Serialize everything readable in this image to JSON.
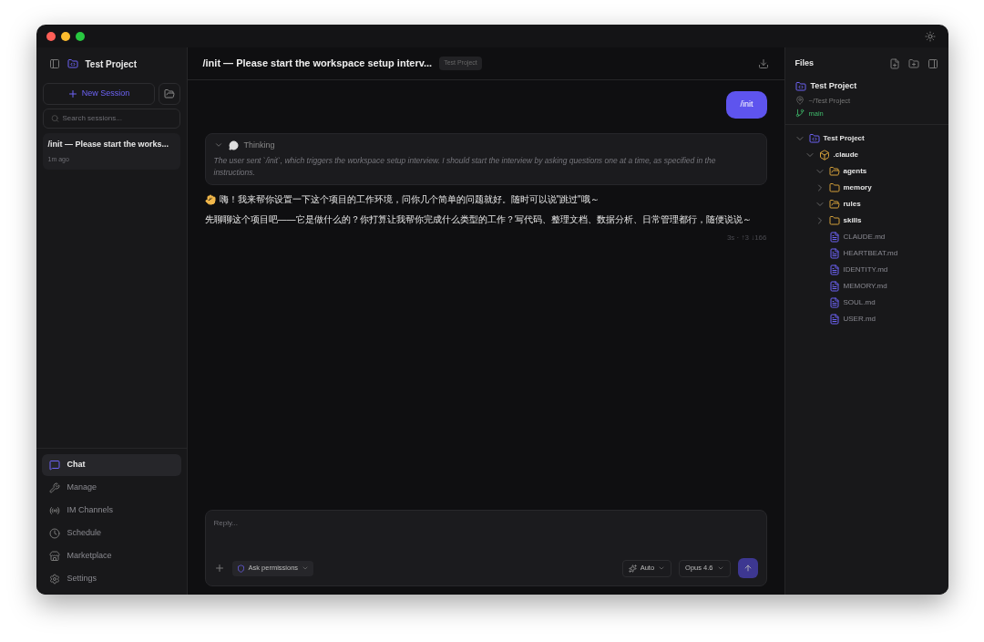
{
  "sidebar": {
    "project": "Test Project",
    "new_session": "New Session",
    "search": {
      "placeholder": "Search sessions..."
    },
    "sessions": [
      {
        "title": "/init — Please start the works...",
        "time": "1m ago"
      }
    ],
    "nav": [
      {
        "label": "Chat",
        "selected": true
      },
      {
        "label": "Manage",
        "selected": false
      },
      {
        "label": "IM Channels",
        "selected": false
      },
      {
        "label": "Schedule",
        "selected": false
      },
      {
        "label": "Marketplace",
        "selected": false
      },
      {
        "label": "Settings",
        "selected": false
      }
    ]
  },
  "chat": {
    "title": "/init — Please start the workspace setup interv...",
    "project_tag": "Test Project",
    "user_message": "/init",
    "thinking": {
      "label": "Thinking",
      "expanded": true,
      "text": "The user sent `/init`, which triggers the workspace setup interview. I should start the interview by asking questions one at a time, as specified in the instructions."
    },
    "reply": [
      "嗨！我来帮你设置一下这个项目的工作环境，问你几个简单的问题就好。随时可以说\"跳过\"哦～",
      "先聊聊这个项目吧——它是做什么的？你打算让我帮你完成什么类型的工作？写代码、整理文档、数据分析、日常管理都行，随便说说～"
    ],
    "stats": "3s · ↑3 ↓166",
    "composer": {
      "placeholder": "Reply...",
      "permissions": "Ask permissions",
      "effort": "Auto",
      "model": "Opus 4.6"
    }
  },
  "files": {
    "title": "Files",
    "project": "Test Project",
    "path": "~/Test Project",
    "branch": "main",
    "tree": [
      {
        "name": "Test Project",
        "kind": "project",
        "expanded": true,
        "children": [
          {
            "name": ".claude",
            "kind": "package",
            "expanded": true,
            "children": [
              {
                "name": "agents",
                "kind": "folder",
                "expanded": true
              },
              {
                "name": "memory",
                "kind": "folder",
                "expanded": false
              },
              {
                "name": "rules",
                "kind": "folder",
                "expanded": true
              },
              {
                "name": "skills",
                "kind": "folder",
                "expanded": false
              },
              {
                "name": "CLAUDE.md",
                "kind": "file"
              },
              {
                "name": "HEARTBEAT.md",
                "kind": "file"
              },
              {
                "name": "IDENTITY.md",
                "kind": "file"
              },
              {
                "name": "MEMORY.md",
                "kind": "file"
              },
              {
                "name": "SOUL.md",
                "kind": "file"
              },
              {
                "name": "USER.md",
                "kind": "file"
              }
            ]
          }
        ]
      }
    ]
  }
}
